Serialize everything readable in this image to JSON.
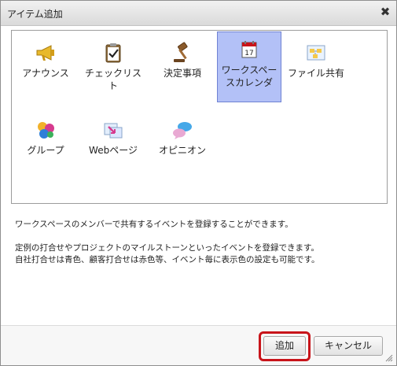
{
  "dialog": {
    "title": "アイテム追加",
    "close_symbol": "✖"
  },
  "items": [
    {
      "label": "アナウンス",
      "icon": "megaphone-icon",
      "selected": false
    },
    {
      "label": "チェックリスト",
      "icon": "clipboard-check-icon",
      "selected": false
    },
    {
      "label": "決定事項",
      "icon": "gavel-icon",
      "selected": false
    },
    {
      "label": "ワークスペースカレンダ",
      "icon": "calendar-icon",
      "selected": true
    },
    {
      "label": "ファイル共有",
      "icon": "file-share-icon",
      "selected": false
    },
    {
      "label": "グループ",
      "icon": "group-bubbles-icon",
      "selected": false
    },
    {
      "label": "Webページ",
      "icon": "webpage-icon",
      "selected": false
    },
    {
      "label": "オピニオン",
      "icon": "speech-bubbles-icon",
      "selected": false
    }
  ],
  "description": {
    "line1": "ワークスペースのメンバーで共有するイベントを登録することができます。",
    "line2": "定例の打合せやプロジェクトのマイルストーンといったイベントを登録できます。",
    "line3": "自社打合せは青色、顧客打合せは赤色等、イベント毎に表示色の設定も可能です。"
  },
  "buttons": {
    "add_label": "追加",
    "cancel_label": "キャンセル"
  },
  "colors": {
    "selected_bg": "#b3c1f7",
    "highlight_border": "#c8141a"
  }
}
